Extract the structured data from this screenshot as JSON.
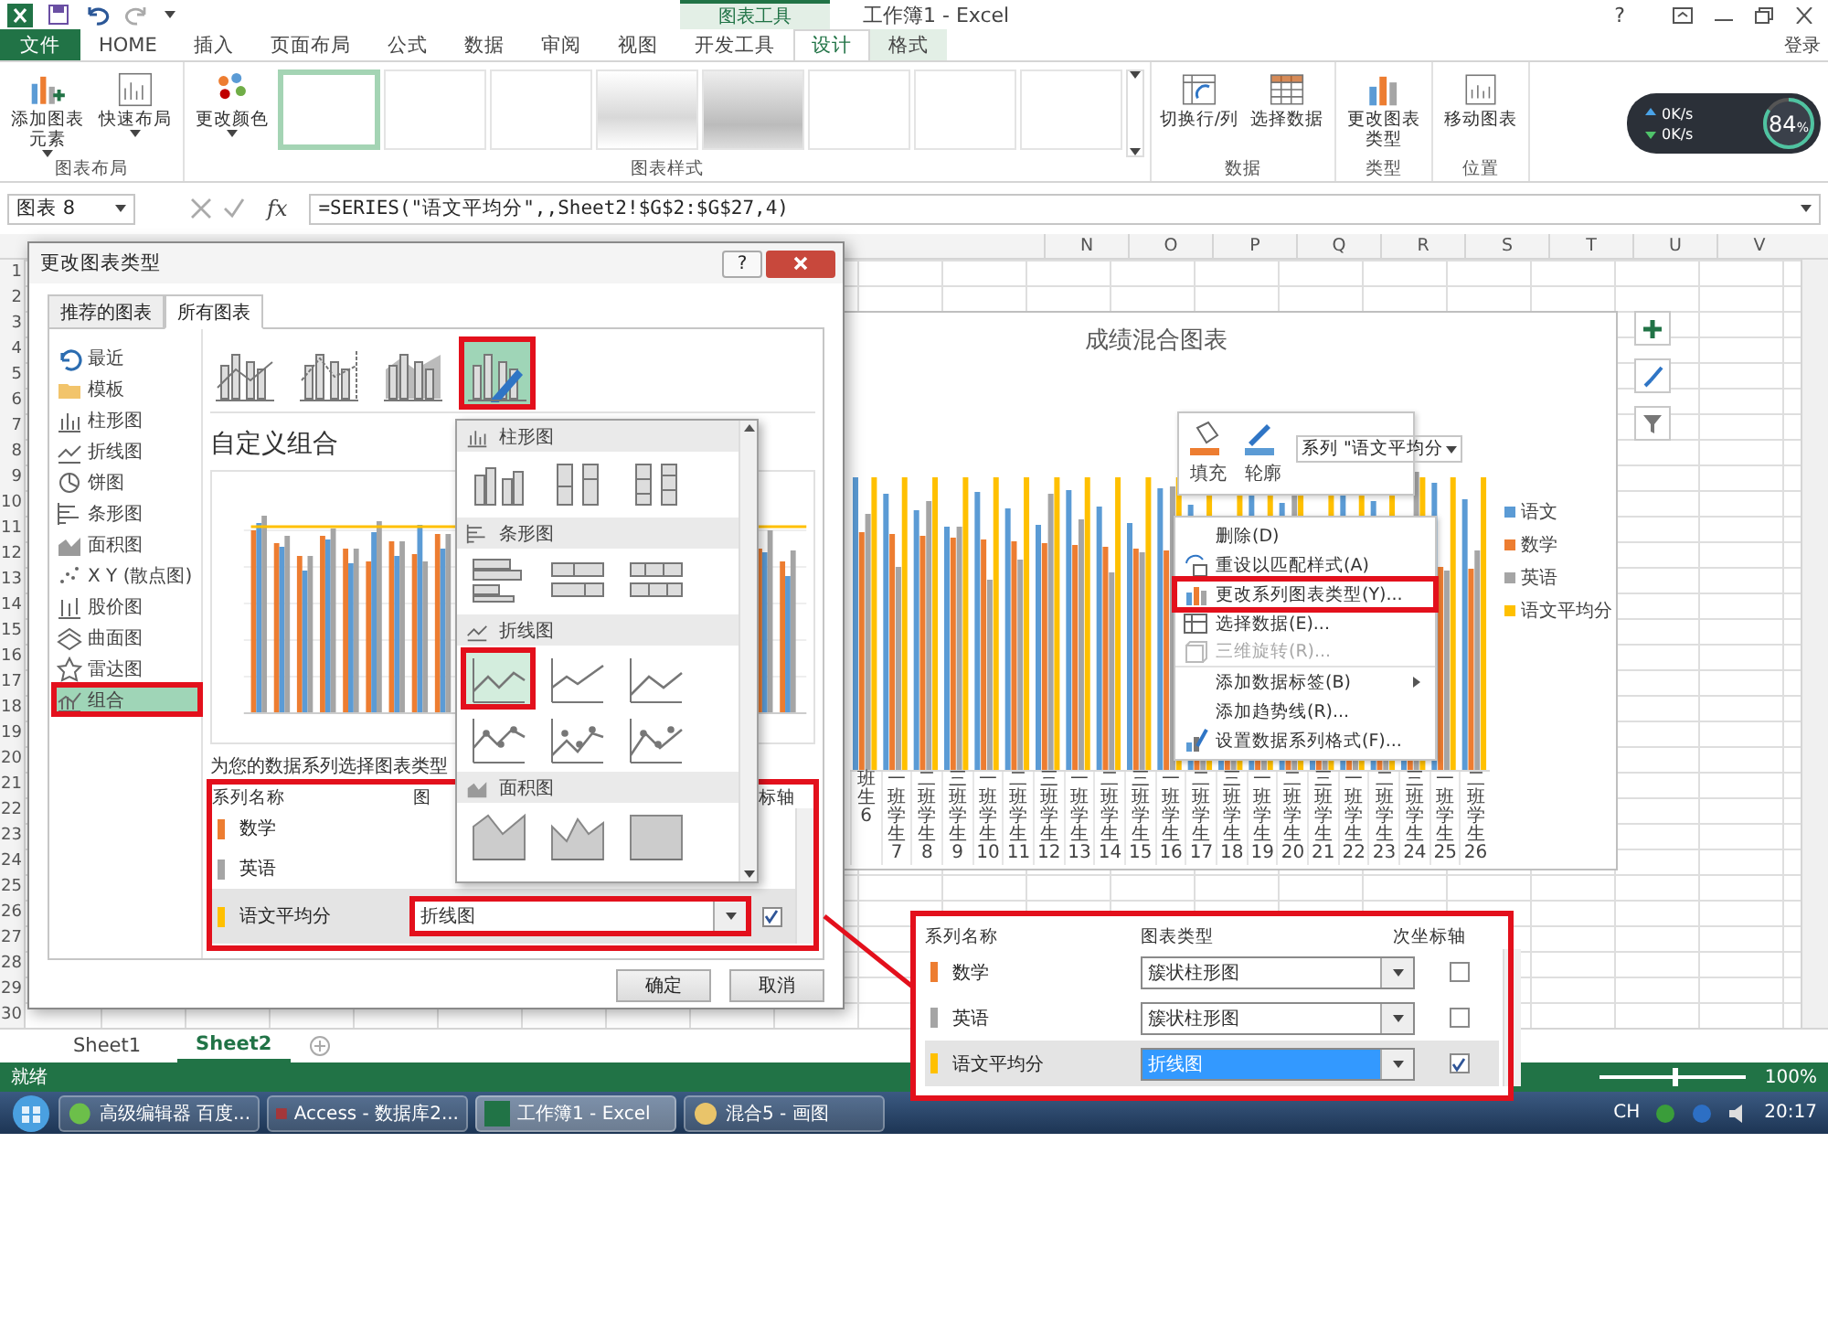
{
  "title_bar": {
    "context_group": "图表工具",
    "title": "工作簿1 - Excel",
    "help": "?"
  },
  "ribbon": {
    "tabs": [
      {
        "label": "文件",
        "kind": "file",
        "selected": false
      },
      {
        "label": "HOME",
        "kind": "tab",
        "selected": false
      },
      {
        "label": "插入",
        "kind": "tab",
        "selected": false
      },
      {
        "label": "页面布局",
        "kind": "tab",
        "selected": false
      },
      {
        "label": "公式",
        "kind": "tab",
        "selected": false
      },
      {
        "label": "数据",
        "kind": "tab",
        "selected": false
      },
      {
        "label": "审阅",
        "kind": "tab",
        "selected": false
      },
      {
        "label": "视图",
        "kind": "tab",
        "selected": false
      },
      {
        "label": "开发工具",
        "kind": "tab",
        "selected": false
      },
      {
        "label": "设计",
        "kind": "context",
        "selected": true
      },
      {
        "label": "格式",
        "kind": "context",
        "selected": false
      }
    ],
    "account": "登录",
    "groups": [
      {
        "label": "图表布局",
        "buttons": [
          {
            "label": "添加图表元素",
            "kind": "add-element",
            "menu": true
          },
          {
            "label": "快速布局",
            "kind": "layout",
            "menu": true
          }
        ]
      },
      {
        "label": "图表样式",
        "buttons": [
          {
            "label": "更改颜色",
            "kind": "colors",
            "menu": true
          }
        ],
        "styles": [
          {
            "kind": "plain",
            "selected": true
          },
          {
            "kind": "plain",
            "selected": false
          },
          {
            "kind": "plain",
            "selected": false
          },
          {
            "kind": "gradient",
            "selected": false
          },
          {
            "kind": "dark",
            "selected": false
          },
          {
            "kind": "plain",
            "selected": false
          },
          {
            "kind": "plain",
            "selected": false
          },
          {
            "kind": "plain",
            "selected": false
          }
        ]
      },
      {
        "label": "数据",
        "buttons": [
          {
            "label": "切换行/列",
            "kind": "switch",
            "menu": false
          },
          {
            "label": "选择数据",
            "kind": "data",
            "menu": false
          }
        ]
      },
      {
        "label": "类型",
        "buttons": [
          {
            "label": "更改图表类型",
            "kind": "change-type",
            "menu": false
          }
        ]
      },
      {
        "label": "位置",
        "buttons": [
          {
            "label": "移动图表",
            "kind": "move",
            "menu": false
          }
        ]
      }
    ]
  },
  "speed_widget": {
    "upload": "0K/s",
    "download": "0K/s",
    "percent": "84",
    "unit": "%",
    "level": 0.84
  },
  "formula_bar": {
    "name_box": "图表 8",
    "fx": "fx",
    "formula": "=SERIES(\"语文平均分\",,Sheet2!$G$2:$G$27,4)"
  },
  "sheet": {
    "columns": [
      "N",
      "O",
      "P",
      "Q",
      "R",
      "S",
      "T",
      "U",
      "V"
    ],
    "rows": [
      "1",
      "2",
      "3",
      "4",
      "5",
      "6",
      "7",
      "8",
      "9",
      "10",
      "11",
      "12",
      "13",
      "14",
      "15",
      "16",
      "17",
      "18",
      "19",
      "20",
      "21",
      "22",
      "23",
      "24",
      "25",
      "26",
      "27",
      "28",
      "29",
      "30"
    ],
    "tabs": [
      {
        "label": "Sheet1",
        "selected": false
      },
      {
        "label": "Sheet2",
        "selected": true
      }
    ]
  },
  "chart": {
    "title": "成绩混合图表",
    "categories": [
      {
        "class": "班",
        "student": "生",
        "number": "6"
      },
      {
        "class": "一班",
        "student": "学生",
        "number": "7"
      },
      {
        "class": "二班",
        "student": "学生",
        "number": "8"
      },
      {
        "class": "三班",
        "student": "学生",
        "number": "9"
      },
      {
        "class": "一班",
        "student": "学生",
        "number": "10"
      },
      {
        "class": "二班",
        "student": "学生",
        "number": "11"
      },
      {
        "class": "三班",
        "student": "学生",
        "number": "12"
      },
      {
        "class": "一班",
        "student": "学生",
        "number": "13"
      },
      {
        "class": "二班",
        "student": "学生",
        "number": "14"
      },
      {
        "class": "三班",
        "student": "学生",
        "number": "15"
      },
      {
        "class": "一班",
        "student": "学生",
        "number": "16"
      },
      {
        "class": "二班",
        "student": "学生",
        "number": "17"
      },
      {
        "class": "三班",
        "student": "学生",
        "number": "18"
      },
      {
        "class": "一班",
        "student": "学生",
        "number": "19"
      },
      {
        "class": "二班",
        "student": "学生",
        "number": "20"
      },
      {
        "class": "三班",
        "student": "学生",
        "number": "21"
      },
      {
        "class": "一班",
        "student": "学生",
        "number": "22"
      },
      {
        "class": "二班",
        "student": "学生",
        "number": "23"
      },
      {
        "class": "三班",
        "student": "学生",
        "number": "24"
      },
      {
        "class": "一班",
        "student": "学生",
        "number": "25"
      },
      {
        "class": "二班",
        "student": "学生",
        "number": "26"
      }
    ],
    "legend": [
      {
        "label": "语文",
        "color": "#5b9bd5"
      },
      {
        "label": "数学",
        "color": "#ed7d31"
      },
      {
        "label": "英语",
        "color": "#a5a5a5"
      },
      {
        "label": "语文平均分",
        "color": "#ffc000"
      }
    ]
  },
  "mini_toolbar": {
    "buttons": [
      {
        "label": "填充",
        "kind": "fill"
      },
      {
        "label": "轮廓",
        "kind": "outline"
      }
    ],
    "series_select": "系列 \"语文平均分"
  },
  "context_menu": [
    {
      "label": "删除(D)",
      "kind": "none",
      "disabled": false,
      "highlighted": false,
      "submenu": false,
      "separator_after": false
    },
    {
      "label": "重设以匹配样式(A)",
      "kind": "reset",
      "disabled": false,
      "highlighted": false,
      "submenu": false,
      "separator_after": false
    },
    {
      "label": "更改系列图表类型(Y)...",
      "kind": "change-type",
      "disabled": false,
      "highlighted": true,
      "submenu": false,
      "separator_after": false
    },
    {
      "label": "选择数据(E)...",
      "kind": "data",
      "disabled": false,
      "highlighted": false,
      "submenu": false,
      "separator_after": false
    },
    {
      "label": "三维旋转(R)...",
      "kind": "rotate",
      "disabled": true,
      "highlighted": false,
      "submenu": false,
      "separator_after": true
    },
    {
      "label": "添加数据标签(B)",
      "kind": "none",
      "disabled": false,
      "highlighted": false,
      "submenu": true,
      "separator_after": false
    },
    {
      "label": "添加趋势线(R)...",
      "kind": "none",
      "disabled": false,
      "highlighted": false,
      "submenu": false,
      "separator_after": false
    },
    {
      "label": "设置数据系列格式(F)...",
      "kind": "format",
      "disabled": false,
      "highlighted": false,
      "submenu": false,
      "separator_after": false
    }
  ],
  "dialog": {
    "title": "更改图表类型",
    "help": "?",
    "tabs": [
      {
        "label": "推荐的图表",
        "selected": false
      },
      {
        "label": "所有图表",
        "selected": true
      }
    ],
    "categories": [
      {
        "label": "最近",
        "kind": "recent",
        "selected": false,
        "highlighted": false
      },
      {
        "label": "模板",
        "kind": "template",
        "selected": false,
        "highlighted": false
      },
      {
        "label": "柱形图",
        "kind": "column",
        "selected": false,
        "highlighted": false
      },
      {
        "label": "折线图",
        "kind": "line",
        "selected": false,
        "highlighted": false
      },
      {
        "label": "饼图",
        "kind": "pie",
        "selected": false,
        "highlighted": false
      },
      {
        "label": "条形图",
        "kind": "bar",
        "selected": false,
        "highlighted": false
      },
      {
        "label": "面积图",
        "kind": "area",
        "selected": false,
        "highlighted": false
      },
      {
        "label": "X Y (散点图)",
        "kind": "scatter",
        "selected": false,
        "highlighted": false
      },
      {
        "label": "股价图",
        "kind": "stock",
        "selected": false,
        "highlighted": false
      },
      {
        "label": "曲面图",
        "kind": "surface",
        "selected": false,
        "highlighted": false
      },
      {
        "label": "雷达图",
        "kind": "radar",
        "selected": false,
        "highlighted": false
      },
      {
        "label": "组合",
        "kind": "combo",
        "selected": true,
        "highlighted": true
      }
    ],
    "combo_types": [
      {
        "kind": "column-line",
        "selected": false,
        "highlighted": false
      },
      {
        "kind": "column-line-axis",
        "selected": false,
        "highlighted": false
      },
      {
        "kind": "area-column",
        "selected": false,
        "highlighted": false
      },
      {
        "kind": "custom",
        "selected": true,
        "highlighted": true
      }
    ],
    "heading": "自定义组合",
    "caption": "为您的数据系列选择图表类型",
    "table": {
      "highlighted": true,
      "columns": [
        "系列名称",
        "图",
        "标轴"
      ],
      "rows": [
        {
          "name": "数学",
          "color": "#ed7d31",
          "selected": false
        },
        {
          "name": "英语",
          "color": "#a5a5a5",
          "selected": false
        },
        {
          "name": "语文平均分",
          "color": "#ffc000",
          "selected": true,
          "chart_type": "折线图",
          "chart_type_highlighted": true,
          "secondary_axis": true
        }
      ]
    },
    "dropdown": [
      {
        "label": "柱形图",
        "kind": "column",
        "options": [
          {
            "selected": false,
            "highlighted": false
          },
          {
            "selected": false,
            "highlighted": false
          },
          {
            "selected": false,
            "highlighted": false
          }
        ]
      },
      {
        "label": "条形图",
        "kind": "bar",
        "options": [
          {
            "selected": false,
            "highlighted": false
          },
          {
            "selected": false,
            "highlighted": false
          },
          {
            "selected": false,
            "highlighted": false
          }
        ]
      },
      {
        "label": "折线图",
        "kind": "line",
        "options": [
          {
            "selected": true,
            "highlighted": true
          },
          {
            "selected": false,
            "highlighted": false
          },
          {
            "selected": false,
            "highlighted": false
          },
          {
            "selected": false,
            "highlighted": false
          },
          {
            "selected": false,
            "highlighted": false
          },
          {
            "selected": false,
            "highlighted": false
          }
        ]
      },
      {
        "label": "面积图",
        "kind": "area",
        "options": [
          {
            "selected": false,
            "highlighted": false
          },
          {
            "selected": false,
            "highlighted": false
          },
          {
            "selected": false,
            "highlighted": false
          }
        ]
      }
    ],
    "buttons": [
      "确定",
      "取消"
    ]
  },
  "callout": {
    "highlighted": true,
    "columns": [
      "系列名称",
      "图表类型",
      "次坐标轴"
    ],
    "rows": [
      {
        "name": "数学",
        "color": "#ed7d31",
        "chart_type": "簇状柱形图",
        "secondary_axis": false,
        "selected": false
      },
      {
        "name": "英语",
        "color": "#a5a5a5",
        "chart_type": "簇状柱形图",
        "secondary_axis": false,
        "selected": false
      },
      {
        "name": "语文平均分",
        "color": "#ffc000",
        "chart_type": "折线图",
        "secondary_axis": true,
        "selected": true
      }
    ]
  },
  "status_bar": {
    "status": "就绪",
    "zoom": "100%",
    "level": 0.5
  },
  "taskbar": {
    "items": [
      {
        "label": "高级编辑器 百度...",
        "kind": "browser",
        "selected": false
      },
      {
        "label": "Access - 数据库2...",
        "kind": "access",
        "selected": false
      },
      {
        "label": "工作簿1 - Excel",
        "kind": "excel",
        "selected": true
      },
      {
        "label": "混合5 - 画图",
        "kind": "paint",
        "selected": false
      }
    ],
    "language": "CH",
    "time": "20:17"
  }
}
